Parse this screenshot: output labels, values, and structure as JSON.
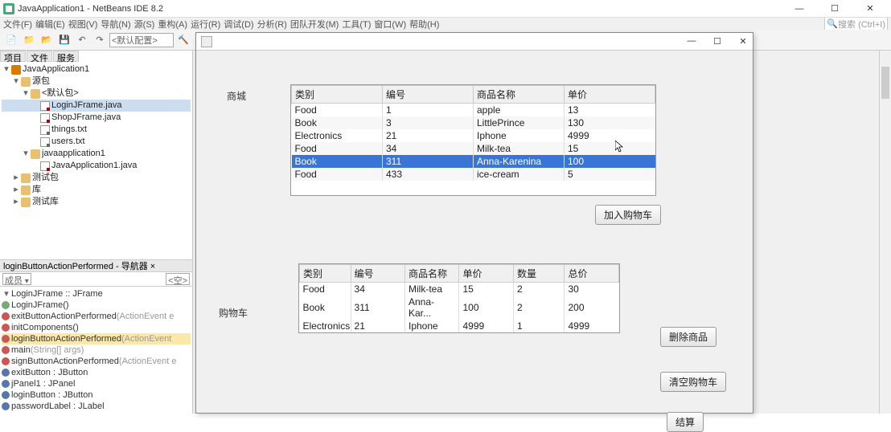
{
  "ide": {
    "title": "JavaApplication1 - NetBeans IDE 8.2",
    "menu": [
      "文件(F)",
      "编辑(E)",
      "视图(V)",
      "导航(N)",
      "源(S)",
      "重构(A)",
      "运行(R)",
      "调试(D)",
      "分析(R)",
      "团队开发(M)",
      "工具(T)",
      "窗口(W)",
      "帮助(H)"
    ],
    "config_label": "<默认配置>",
    "search_placeholder": "搜索 (Ctrl+I)",
    "tabs": [
      "项目",
      "文件",
      "服务"
    ]
  },
  "project_tree": {
    "root": "JavaApplication1",
    "src": "源包",
    "pkg_default": "<默认包>",
    "files_default": [
      "LoginJFrame.java",
      "ShopJFrame.java",
      "things.txt",
      "users.txt"
    ],
    "pkg_app": "javaapplication1",
    "files_app": [
      "JavaApplication1.java"
    ],
    "test_pkg": "测试包",
    "lib": "库",
    "test_lib": "测试库"
  },
  "navigator": {
    "header": "loginButtonActionPerformed - 导航器 ×",
    "combo": "成员",
    "empty": "<空>",
    "class_line": "LoginJFrame :: JFrame",
    "items": [
      {
        "b": "green",
        "txt": "LoginJFrame()",
        "param": ""
      },
      {
        "b": "red",
        "txt": "exitButtonActionPerformed",
        "param": "(ActionEvent e"
      },
      {
        "b": "red",
        "txt": "initComponents()",
        "param": ""
      },
      {
        "b": "red",
        "txt": "loginButtonActionPerformed",
        "param": "(ActionEvent",
        "hl": true
      },
      {
        "b": "red",
        "txt": "main",
        "param": "(String[] args)"
      },
      {
        "b": "red",
        "txt": "signButtonActionPerformed",
        "param": "(ActionEvent e"
      },
      {
        "b": "blue",
        "txt": "exitButton : JButton",
        "param": ""
      },
      {
        "b": "blue",
        "txt": "jPanel1 : JPanel",
        "param": ""
      },
      {
        "b": "blue",
        "txt": "loginButton : JButton",
        "param": ""
      },
      {
        "b": "blue",
        "txt": "passwordLabel : JLabel",
        "param": ""
      }
    ]
  },
  "dialog": {
    "shop_label": "商城",
    "cart_label": "购物车",
    "shop_headers": [
      "类别",
      "编号",
      "商品名称",
      "单价"
    ],
    "shop_rows": [
      {
        "cat": "Food",
        "id": "1",
        "name": "apple",
        "price": "13"
      },
      {
        "cat": "Book",
        "id": "3",
        "name": "LittlePrince",
        "price": "130"
      },
      {
        "cat": "Electronics",
        "id": "21",
        "name": "Iphone",
        "price": "4999"
      },
      {
        "cat": "Food",
        "id": "34",
        "name": "Milk-tea",
        "price": "15"
      },
      {
        "cat": "Book",
        "id": "311",
        "name": "Anna-Karenina",
        "price": "100",
        "selected": true
      },
      {
        "cat": "Food",
        "id": "433",
        "name": "ice-cream",
        "price": "5"
      }
    ],
    "cart_headers": [
      "类别",
      "编号",
      "商品名称",
      "单价",
      "数量",
      "总价"
    ],
    "cart_rows": [
      {
        "cat": "Food",
        "id": "34",
        "name": "Milk-tea",
        "price": "15",
        "qty": "2",
        "total": "30"
      },
      {
        "cat": "Book",
        "id": "311",
        "name": "Anna-Kar...",
        "price": "100",
        "qty": "2",
        "total": "200"
      },
      {
        "cat": "Electronics",
        "id": "21",
        "name": "Iphone",
        "price": "4999",
        "qty": "1",
        "total": "4999"
      }
    ],
    "btn_add": "加入购物车",
    "btn_del": "删除商品",
    "btn_clear": "清空购物车",
    "btn_checkout": "结算"
  }
}
